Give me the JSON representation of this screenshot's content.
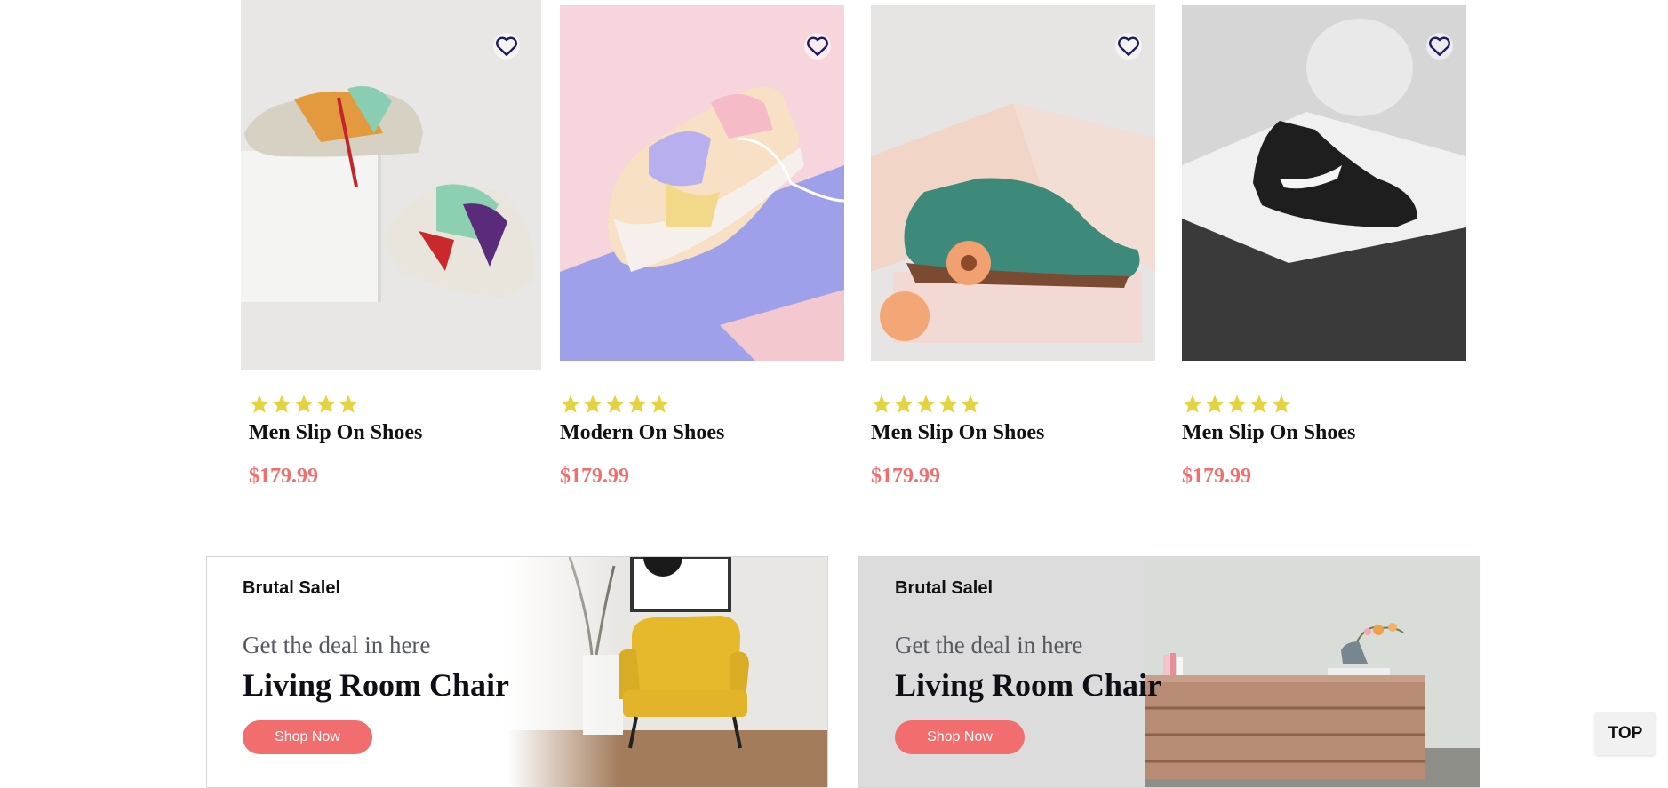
{
  "products": [
    {
      "name": "Men Slip On Shoes",
      "price": "$179.99",
      "rating": 5,
      "wishlist_icon": "heart-outline-icon"
    },
    {
      "name": "Modern On Shoes",
      "price": "$179.99",
      "rating": 5,
      "wishlist_icon": "heart-outline-icon"
    },
    {
      "name": "Men Slip On Shoes",
      "price": "$179.99",
      "rating": 5,
      "wishlist_icon": "heart-outline-icon"
    },
    {
      "name": "Men Slip On Shoes",
      "price": "$179.99",
      "rating": 5,
      "wishlist_icon": "heart-outline-icon"
    }
  ],
  "banners": [
    {
      "tag": "Brutal Salel",
      "subtitle": "Get the deal in here",
      "title": "Living Room Chair",
      "button": "Shop Now"
    },
    {
      "tag": "Brutal Salel",
      "subtitle": "Get the deal in here",
      "title": "Living Room Chair",
      "button": "Shop Now"
    }
  ],
  "scroll_top": {
    "label": "TOP"
  },
  "colors": {
    "accent": "#f26d6d",
    "star": "#e4d33c",
    "heart": "#1b1b5e"
  }
}
